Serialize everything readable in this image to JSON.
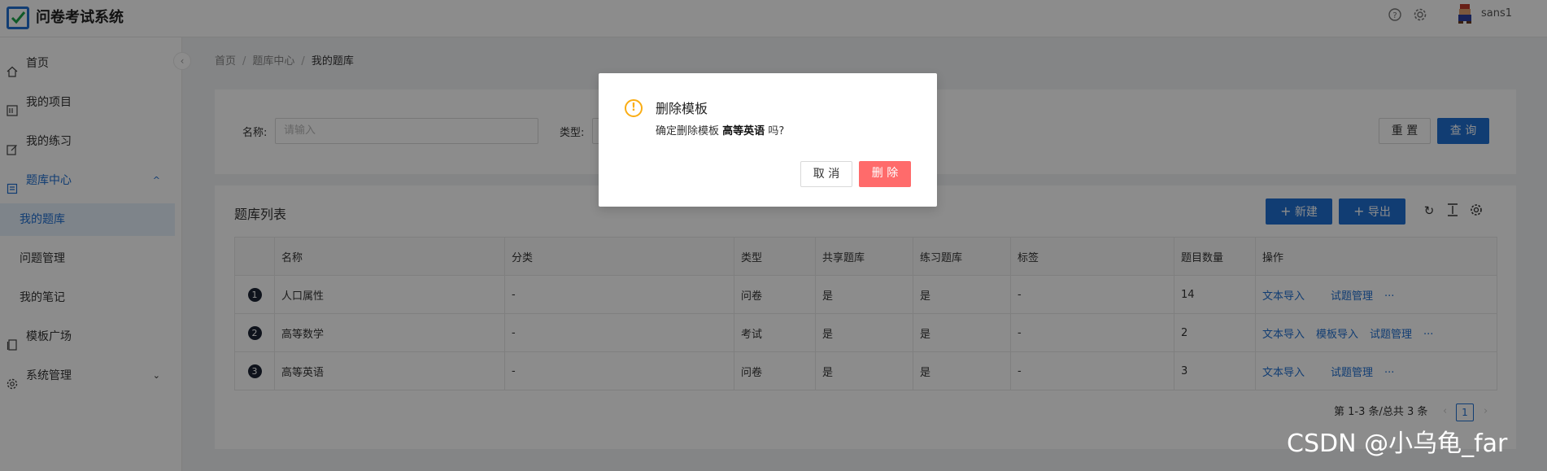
{
  "header": {
    "app_title": "问卷考试系统",
    "username": "sans1"
  },
  "sidebar": {
    "items": [
      {
        "label": "首页",
        "icon": "home-icon"
      },
      {
        "label": "我的项目",
        "icon": "project-icon"
      },
      {
        "label": "我的练习",
        "icon": "edit-icon"
      },
      {
        "label": "题库中心",
        "icon": "bank-icon",
        "expanded": true
      },
      {
        "label": "我的题库",
        "selected": true
      },
      {
        "label": "问题管理"
      },
      {
        "label": "我的笔记"
      },
      {
        "label": "模板广场",
        "icon": "template-icon"
      },
      {
        "label": "系统管理",
        "icon": "settings-icon",
        "expanded": false
      }
    ]
  },
  "breadcrumb": {
    "items": [
      "首页",
      "题库中心",
      "我的题库"
    ],
    "separator": "/"
  },
  "search": {
    "name_label": "名称:",
    "name_placeholder": "请输入",
    "type_label": "类型:",
    "reset_label": "重 置",
    "query_label": "查 询"
  },
  "table_card": {
    "title": "题库列表",
    "new_label": "新建",
    "export_label": "导出",
    "columns": [
      "名称",
      "分类",
      "类型",
      "共享题库",
      "练习题库",
      "标签",
      "题目数量",
      "操作"
    ],
    "rows": [
      {
        "index": "1",
        "name": "人口属性",
        "category": "-",
        "type": "问卷",
        "shared": "是",
        "practice": "是",
        "tags": "-",
        "count": "14",
        "ops": [
          "文本导入",
          "试题管理"
        ],
        "more": "···"
      },
      {
        "index": "2",
        "name": "高等数学",
        "category": "-",
        "type": "考试",
        "shared": "是",
        "practice": "是",
        "tags": "-",
        "count": "2",
        "ops": [
          "文本导入",
          "模板导入",
          "试题管理"
        ],
        "more": "···"
      },
      {
        "index": "3",
        "name": "高等英语",
        "category": "-",
        "type": "问卷",
        "shared": "是",
        "practice": "是",
        "tags": "-",
        "count": "3",
        "ops": [
          "文本导入",
          "试题管理"
        ],
        "more": "···"
      }
    ],
    "pager_text": "第 1-3 条/总共 3 条",
    "current_page": "1"
  },
  "modal": {
    "title": "删除模板",
    "body_prefix": "确定删除模板",
    "body_name": "高等英语",
    "body_suffix": "吗?",
    "cancel_label": "取 消",
    "delete_label": "删 除"
  },
  "watermark": "CSDN @小乌龟_far",
  "colors": {
    "primary": "#1f6fd1",
    "danger": "#ff6b6b",
    "warning": "#faad14"
  }
}
